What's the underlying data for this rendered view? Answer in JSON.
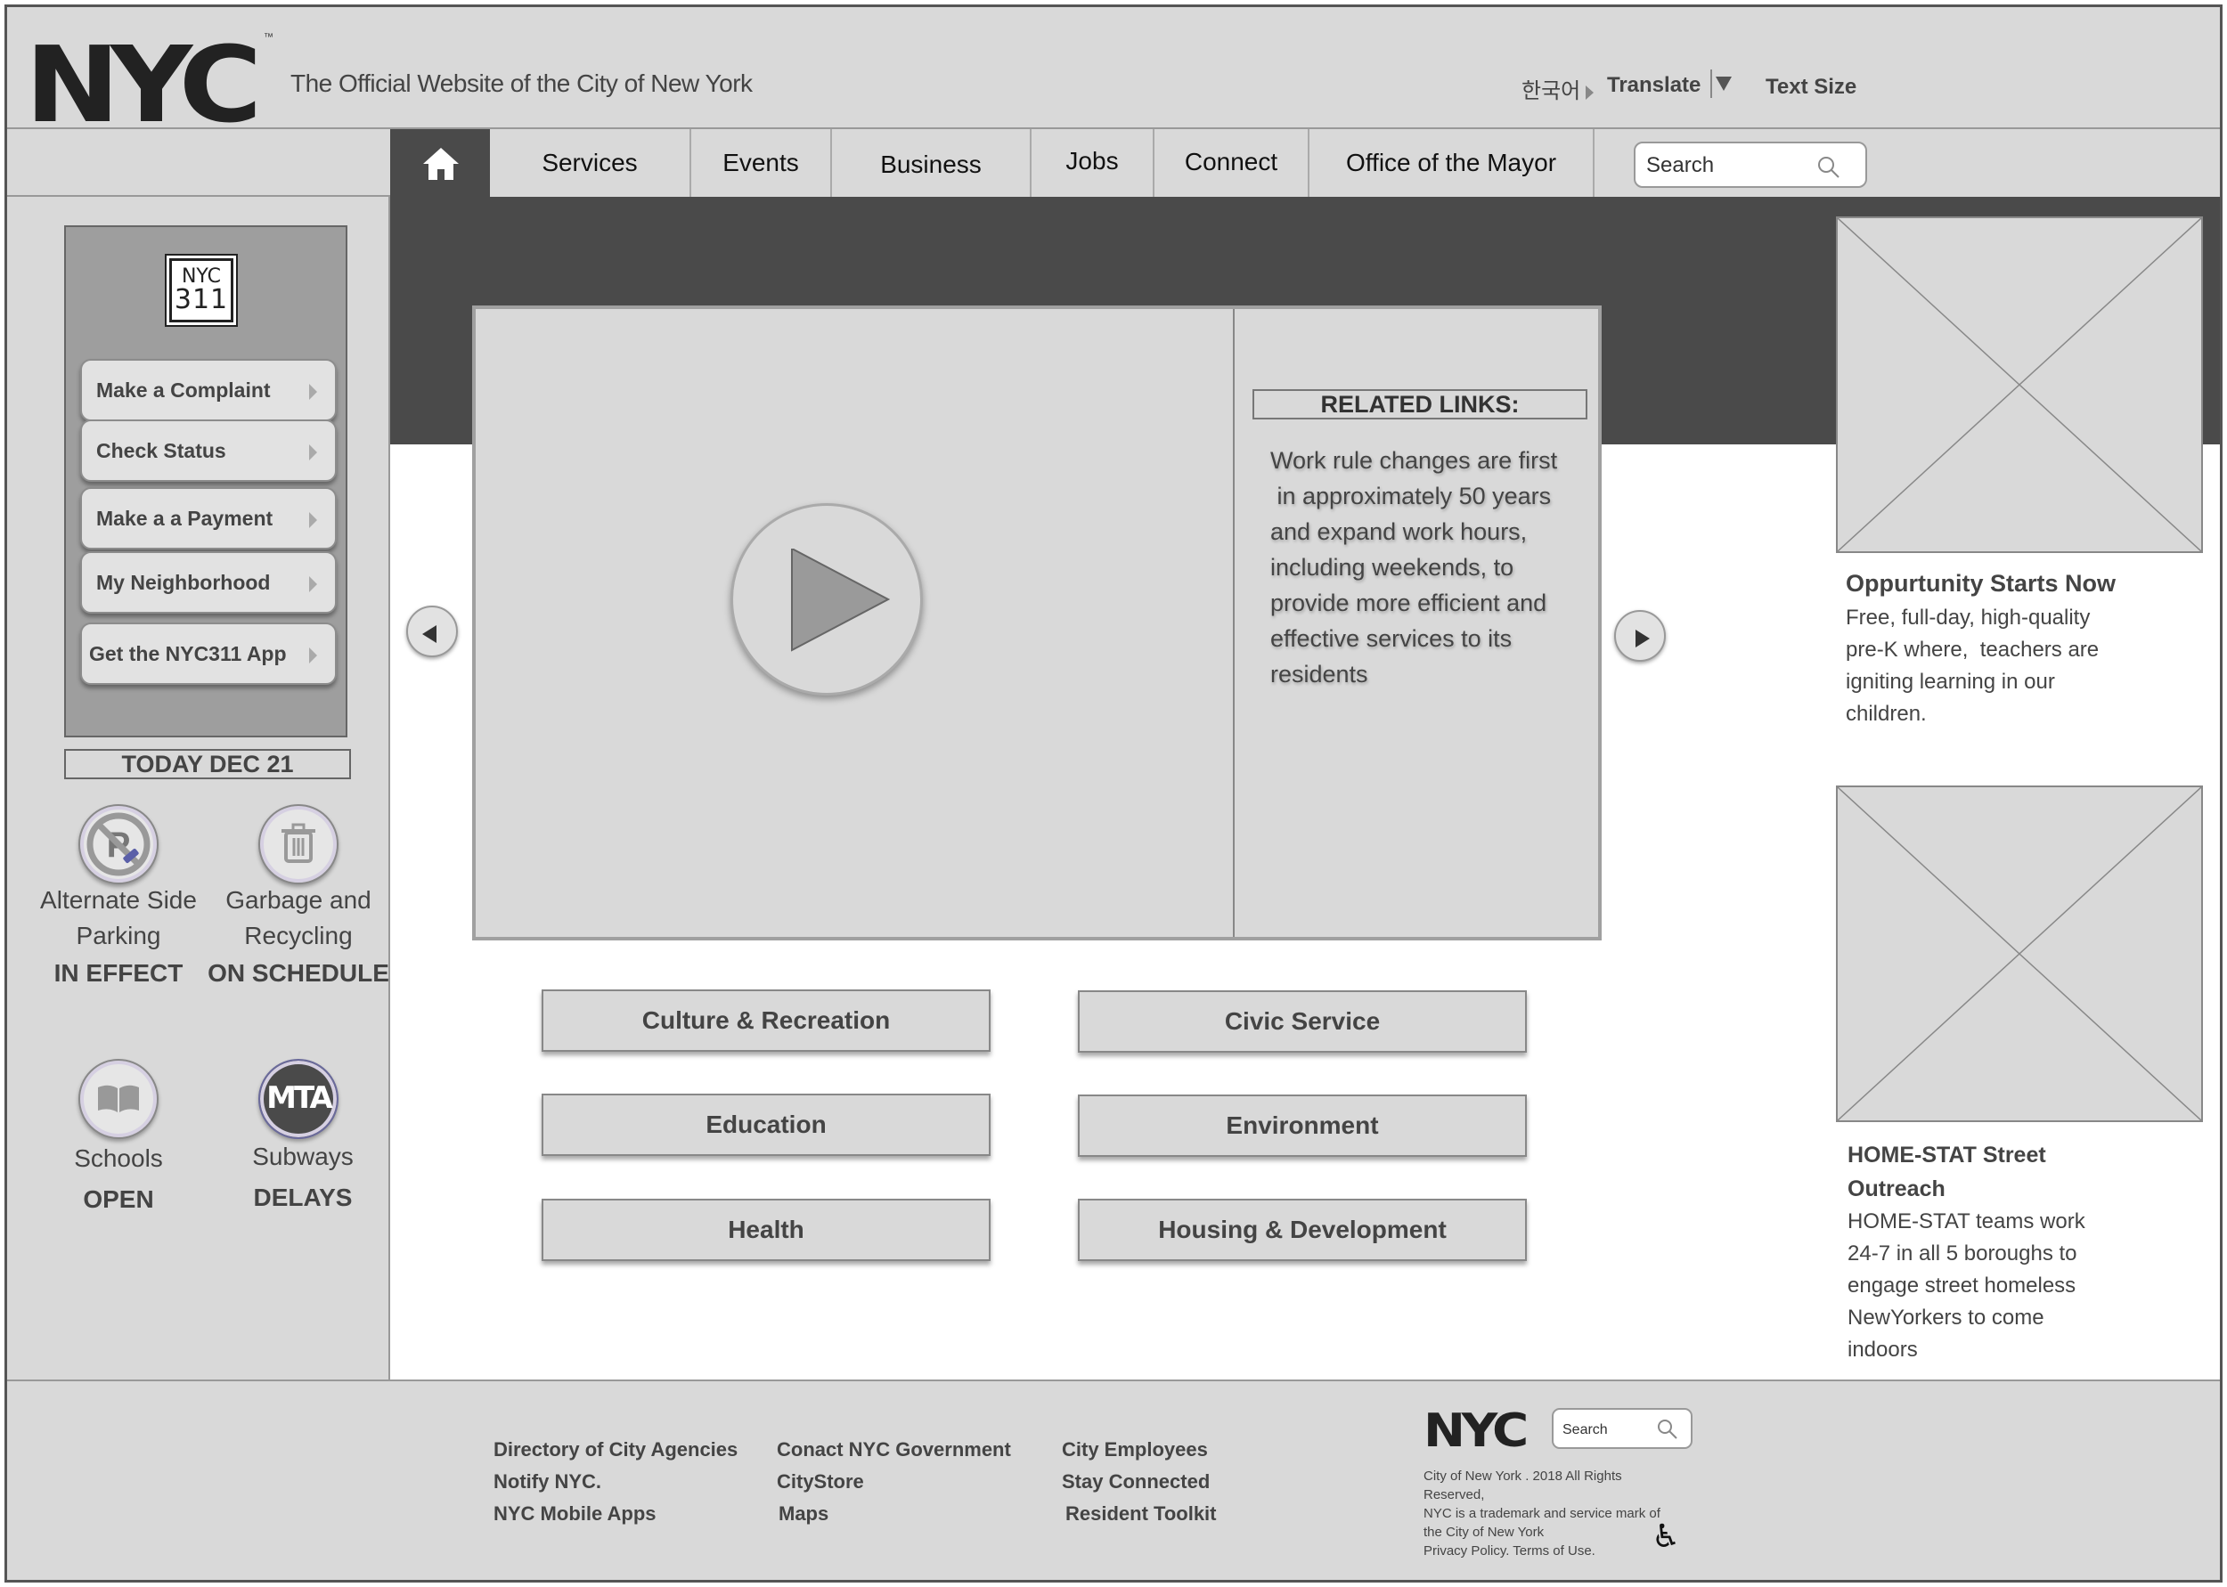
{
  "header": {
    "logo_text": "NYC",
    "logo_tm": "™",
    "tagline": "The Official Website of the City of New York",
    "language": "한국어",
    "translate": "Translate",
    "text_size": "Text Size"
  },
  "nav": {
    "items": [
      {
        "label": "Services"
      },
      {
        "label": "Events"
      },
      {
        "label": "Business"
      },
      {
        "label": "Jobs"
      },
      {
        "label": "Connect"
      },
      {
        "label": "Office of the Mayor"
      }
    ],
    "search_placeholder": "Search"
  },
  "sidebar": {
    "logo_311_line1": "NYC",
    "logo_311_line2": "311",
    "buttons": [
      {
        "label": "Make a Complaint"
      },
      {
        "label": "Check Status"
      },
      {
        "label": "Make a a Payment"
      },
      {
        "label": "My Neighborhood"
      },
      {
        "label": "Get the NYC311 App"
      }
    ],
    "today": "TODAY DEC 21",
    "statuses": [
      {
        "label_line1": "Alternate Side",
        "label_line2": "Parking",
        "value": "IN EFFECT",
        "icon": "no-parking-icon"
      },
      {
        "label_line1": "Garbage and",
        "label_line2": "Recycling",
        "value": "ON SCHEDULE",
        "icon": "trash-icon"
      },
      {
        "label_line1": "Schools",
        "value": "OPEN",
        "icon": "book-icon"
      },
      {
        "label_line1": "Subways",
        "value": "DELAYS",
        "icon": "mta-icon",
        "icon_text": "MTA"
      }
    ]
  },
  "hero": {
    "related_title": "RELATED LINKS:",
    "related_lines": [
      "Work rule changes are first",
      " in approximately 50 years",
      "and expand work hours,",
      "including weekends, to",
      "provide more efficient and",
      "effective services to its",
      "residents"
    ]
  },
  "categories": [
    {
      "label": "Culture & Recreation"
    },
    {
      "label": "Civic Service"
    },
    {
      "label": "Education"
    },
    {
      "label": "Environment"
    },
    {
      "label": "Health"
    },
    {
      "label": "Housing & Development"
    }
  ],
  "cards": [
    {
      "title_lines": [
        "Oppurtunity Starts Now"
      ],
      "text_lines": [
        "Free, full-day, high-quality",
        "pre-K where,  teachers are",
        "igniting learning in our",
        "children."
      ]
    },
    {
      "title_lines": [
        "HOME-STAT Street",
        "Outreach"
      ],
      "text_lines": [
        "HOME-STAT teams work",
        "24-7 in all 5 boroughs to",
        "engage street homeless",
        "NewYorkers to come",
        "indoors"
      ]
    }
  ],
  "footer": {
    "links": [
      [
        "Directory of City Agencies",
        "Notify NYC.",
        "NYC Mobile Apps"
      ],
      [
        "Conact NYC Government",
        "CityStore",
        "Maps"
      ],
      [
        "City Employees",
        "Stay Connected",
        "Resident Toolkit"
      ]
    ],
    "logo_text": "NYC",
    "search_placeholder": "Search",
    "copyright_lines": [
      "City of New York . 2018 All Rights",
      "Reserved,",
      "NYC is a trademark and service mark of",
      "the City of New York",
      "Privacy Policy. Terms of Use."
    ],
    "accessibility_icon": "wheelchair-icon"
  },
  "colors": {
    "panel_gray": "#d9d9d9",
    "dark_band": "#4a4a4a",
    "text_gray": "#444444"
  }
}
